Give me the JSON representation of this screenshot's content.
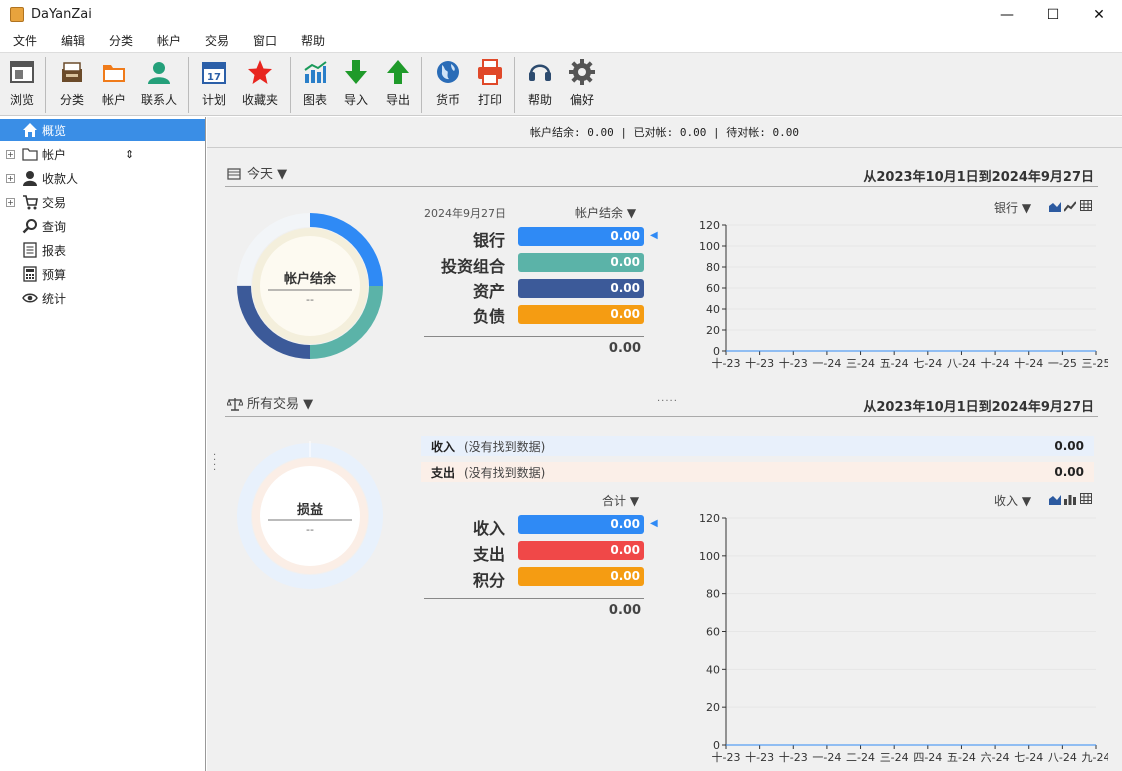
{
  "window": {
    "title": "DaYanZai",
    "minimize": "—",
    "maximize": "☐",
    "close": "✕"
  },
  "menu": [
    "文件",
    "编辑",
    "分类",
    "帐户",
    "交易",
    "窗口",
    "帮助"
  ],
  "toolbar": [
    {
      "label": "浏览",
      "icon": "browse-icon"
    },
    {
      "label": "分类",
      "icon": "category-icon"
    },
    {
      "label": "帐户",
      "icon": "account-folder-icon"
    },
    {
      "label": "联系人",
      "icon": "contact-icon"
    },
    {
      "label": "计划",
      "icon": "calendar-icon"
    },
    {
      "label": "收藏夹",
      "icon": "star-icon"
    },
    {
      "label": "图表",
      "icon": "chart-icon"
    },
    {
      "label": "导入",
      "icon": "import-icon"
    },
    {
      "label": "导出",
      "icon": "export-icon"
    },
    {
      "label": "货币",
      "icon": "globe-icon"
    },
    {
      "label": "打印",
      "icon": "printer-icon"
    },
    {
      "label": "帮助",
      "icon": "headset-icon"
    },
    {
      "label": "偏好",
      "icon": "gear-icon"
    }
  ],
  "sidebar": [
    {
      "label": "概览",
      "icon": "home-icon",
      "selected": true
    },
    {
      "label": "帐户",
      "icon": "folder-icon",
      "expand": true,
      "sort": "⇕"
    },
    {
      "label": "收款人",
      "icon": "person-icon",
      "expand": true
    },
    {
      "label": "交易",
      "icon": "cart-icon",
      "expand": true
    },
    {
      "label": "查询",
      "icon": "search-icon"
    },
    {
      "label": "报表",
      "icon": "report-icon"
    },
    {
      "label": "预算",
      "icon": "calculator-icon"
    },
    {
      "label": "统计",
      "icon": "eye-icon"
    }
  ],
  "status": "帐户结余: 0.00 | 已对帐: 0.00 | 待对帐: 0.00",
  "balance": {
    "period_label": "今天 ▼",
    "date_range": "从2023年10月1日到2024年9月27日",
    "date": "2024年9月27日",
    "mode": "帐户结余 ▼",
    "donut_title": "帐户结余",
    "donut_sub": "--",
    "rows": [
      {
        "label": "银行",
        "value": "0.00",
        "color": "#2f8af5"
      },
      {
        "label": "投资组合",
        "value": "0.00",
        "color": "#5bb3a8"
      },
      {
        "label": "资产",
        "value": "0.00",
        "color": "#3c5a99"
      },
      {
        "label": "负债",
        "value": "0.00",
        "color": "#f59c12"
      }
    ],
    "total": "0.00",
    "chart_selector": "银行 ▼",
    "marker": "◀"
  },
  "transactions": {
    "period_label": "所有交易 ▼",
    "date_range": "从2023年10月1日到2024年9月27日",
    "income": {
      "label": "收入",
      "note": "(没有找到数据)",
      "value": "0.00"
    },
    "expense": {
      "label": "支出",
      "note": "(没有找到数据)",
      "value": "0.00"
    },
    "mode": "合计 ▼",
    "donut_title": "损益",
    "donut_sub": "--",
    "rows": [
      {
        "label": "收入",
        "value": "0.00",
        "color": "#2f8af5"
      },
      {
        "label": "支出",
        "value": "0.00",
        "color": "#f04848"
      },
      {
        "label": "积分",
        "value": "0.00",
        "color": "#f59c12"
      }
    ],
    "total": "0.00",
    "chart_selector": "收入 ▼",
    "marker": "◀"
  },
  "chart_data": [
    {
      "type": "area",
      "categories": [
        "十-23",
        "十-23",
        "十-23",
        "一-24",
        "三-24",
        "五-24",
        "七-24",
        "八-24",
        "十-24",
        "十-24",
        "一-25",
        "三-25"
      ],
      "values": [
        0,
        0,
        0,
        0,
        0,
        0,
        0,
        0,
        0,
        0,
        0,
        0
      ],
      "yticks": [
        0,
        20,
        40,
        60,
        80,
        100,
        120
      ],
      "ylim": [
        0,
        120
      ],
      "grid": true
    },
    {
      "type": "area",
      "categories": [
        "十-23",
        "十-23",
        "十-23",
        "一-24",
        "二-24",
        "三-24",
        "四-24",
        "五-24",
        "六-24",
        "七-24",
        "八-24",
        "九-24"
      ],
      "values": [
        0,
        0,
        0,
        0,
        0,
        0,
        0,
        0,
        0,
        0,
        0,
        0
      ],
      "yticks": [
        0,
        20,
        40,
        60,
        80,
        100,
        120
      ],
      "ylim": [
        0,
        120
      ],
      "grid": true
    }
  ]
}
